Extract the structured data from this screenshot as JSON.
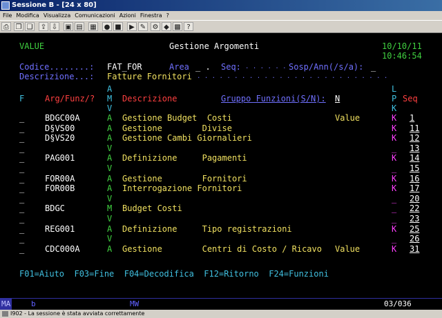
{
  "window": {
    "title": "Sessione B - [24 x 80]"
  },
  "menu": [
    "File",
    "Modifica",
    "Visualizza",
    "Comunicazioni",
    "Azioni",
    "Finestra",
    "?"
  ],
  "toolbar_icons": [
    "print-icon",
    "copy-icon",
    "paste-icon",
    "send-icon",
    "receive-icon",
    "display-icon",
    "color-icon",
    "clipboard-icon",
    "macro-record-icon",
    "macro-stop-icon",
    "macro-play-icon",
    "macro-edit-icon",
    "macro-run-icon",
    "macro-icon",
    "applet-icon",
    "help-icon"
  ],
  "header": {
    "value_label": "VALUE",
    "title": "Gestione Argomenti",
    "date": "10/10/11",
    "time": "10:46:54"
  },
  "form": {
    "codice_label": "Codice........:",
    "codice_value": "FAT_FOR",
    "area_label": "Area",
    "area_value": "_ .",
    "seq_label": "Seq:",
    "seq_value": ". . . . . .",
    "sosp_label": "Sosp/Ann(/s/a):",
    "sosp_value": "_",
    "descr_label": "Descrizione...:",
    "descr_value": "Fatture Fornitori",
    "descr_dots": ". . . . . . . . . . . . . . . . . . . . . . . . . ."
  },
  "columns": {
    "f": "F",
    "arg": "Arg/Funz/?",
    "amv": [
      "A",
      "M",
      "V"
    ],
    "descr": "Descrizione",
    "gruppo": "Gruppo Funzioni(S/N):",
    "gruppo_value": "N",
    "lpk": [
      "L",
      "P",
      "K"
    ],
    "seq": "Seq"
  },
  "rows": [
    {
      "f": "_",
      "arg": "BDGC00A",
      "amv": "A",
      "descr": "Gestione Budget  Costi",
      "extra": "Value",
      "k": "K",
      "seq": "1"
    },
    {
      "f": "_",
      "arg": "D§VS00",
      "amv": "A",
      "descr": "Gestione        Divise",
      "extra": "",
      "k": "K",
      "seq": "11"
    },
    {
      "f": "_",
      "arg": "D§VS20",
      "amv": "A",
      "descr": "Gestione Cambi Giornalieri",
      "extra": "",
      "k": "K",
      "seq": "12"
    },
    {
      "f": "_",
      "arg": "",
      "amv": "V",
      "descr": "",
      "extra": "",
      "k": "_",
      "seq": "13"
    },
    {
      "f": "_",
      "arg": "PAG001",
      "amv": "A",
      "descr": "Definizione     Pagamenti",
      "extra": "",
      "k": "K",
      "seq": "14"
    },
    {
      "f": "_",
      "arg": "",
      "amv": "V",
      "descr": "",
      "extra": "",
      "k": "_",
      "seq": "15"
    },
    {
      "f": "_",
      "arg": "FOR00A",
      "amv": "A",
      "descr": "Gestione        Fornitori",
      "extra": "",
      "k": "K",
      "seq": "16"
    },
    {
      "f": "_",
      "arg": "FOR00B",
      "amv": "A",
      "descr": "Interrogazione Fornitori",
      "extra": "",
      "k": "K",
      "seq": "17"
    },
    {
      "f": "_",
      "arg": "",
      "amv": "V",
      "descr": "",
      "extra": "",
      "k": "_",
      "seq": "20"
    },
    {
      "f": "_",
      "arg": "BDGC",
      "amv": "M",
      "descr": "Budget Costi",
      "extra": "",
      "k": "_",
      "seq": "22"
    },
    {
      "f": "_",
      "arg": "",
      "amv": "V",
      "descr": "",
      "extra": "",
      "k": "_",
      "seq": "23"
    },
    {
      "f": "_",
      "arg": "REG001",
      "amv": "A",
      "descr": "Definizione     Tipo registrazioni",
      "extra": "",
      "k": "K",
      "seq": "25"
    },
    {
      "f": "_",
      "arg": "",
      "amv": "V",
      "descr": "",
      "extra": "",
      "k": "_",
      "seq": "26"
    },
    {
      "f": "_",
      "arg": "CDC000A",
      "amv": "A",
      "descr": "Gestione        Centri di Costo / Ricavo",
      "extra": "Value",
      "k": "K",
      "seq": "31"
    }
  ],
  "fkeys": "F01=Aiuto  F03=Fine  F04=Decodifica  F12=Ritorno  F24=Funzioni",
  "oia": {
    "ma": "MA",
    "b": "b",
    "mw": "MW",
    "pos": "03/036"
  },
  "statusbar": {
    "text": "I902 - La sessione è stata avviata correttamente"
  }
}
